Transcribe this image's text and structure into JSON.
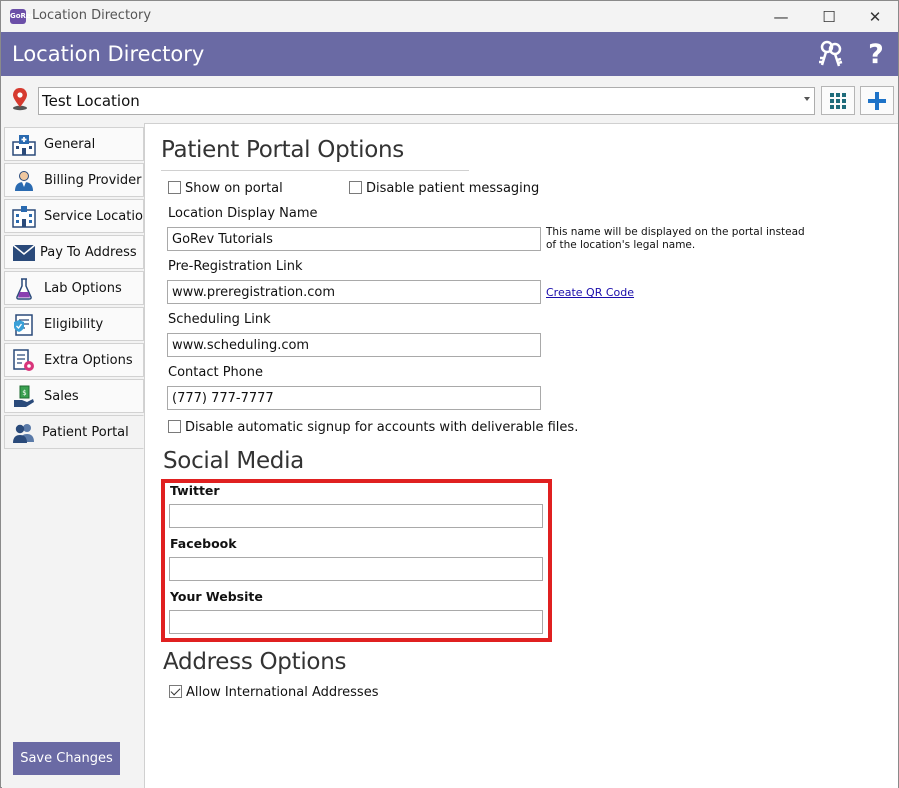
{
  "window": {
    "app_icon_text": "GoRev",
    "title": "Location Directory",
    "controls": {
      "minimize": "—",
      "maximize": "☐",
      "close": "✕"
    }
  },
  "header": {
    "title": "Location Directory",
    "help_label": "?"
  },
  "location": {
    "selected": "Test Location"
  },
  "sidebar": {
    "items": [
      {
        "label": "General",
        "icon": "hospital-icon"
      },
      {
        "label": "Billing Provider",
        "icon": "doctor-icon"
      },
      {
        "label": "Service Location",
        "icon": "building-icon"
      },
      {
        "label": "Pay To Address",
        "icon": "envelope-icon"
      },
      {
        "label": "Lab Options",
        "icon": "flask-icon"
      },
      {
        "label": "Eligibility",
        "icon": "checklist-shield-icon"
      },
      {
        "label": "Extra Options",
        "icon": "document-gear-icon"
      },
      {
        "label": "Sales",
        "icon": "money-hand-icon"
      },
      {
        "label": "Patient Portal",
        "icon": "users-icon"
      }
    ],
    "active_index": 8,
    "save_label": "Save Changes"
  },
  "portal": {
    "title": "Patient Portal Options",
    "show_on_portal": {
      "label": "Show on portal",
      "checked": false
    },
    "disable_messaging": {
      "label": "Disable patient messaging",
      "checked": false
    },
    "display_name": {
      "label": "Location Display Name",
      "value": "GoRev Tutorials",
      "hint": "This name will be displayed on the portal instead of the location's legal name."
    },
    "prereg": {
      "label": "Pre-Registration Link",
      "value": "www.preregistration.com",
      "link": "Create QR Code"
    },
    "scheduling": {
      "label": "Scheduling Link",
      "value": "www.scheduling.com"
    },
    "phone": {
      "label": "Contact Phone",
      "value": "(777) 777-7777"
    },
    "disable_signup": {
      "label": "Disable automatic signup for accounts with deliverable files.",
      "checked": false
    }
  },
  "social": {
    "title": "Social Media",
    "twitter": {
      "label": "Twitter",
      "value": ""
    },
    "facebook": {
      "label": "Facebook",
      "value": ""
    },
    "website": {
      "label": "Your Website",
      "value": ""
    },
    "highlight_color": "#e02020"
  },
  "address": {
    "title": "Address Options",
    "intl": {
      "label": "Allow International Addresses",
      "checked": true
    }
  },
  "colors": {
    "header_bg": "#6a6aa4",
    "accent_blue": "#1e73c8",
    "pin_red": "#d63a2f"
  }
}
